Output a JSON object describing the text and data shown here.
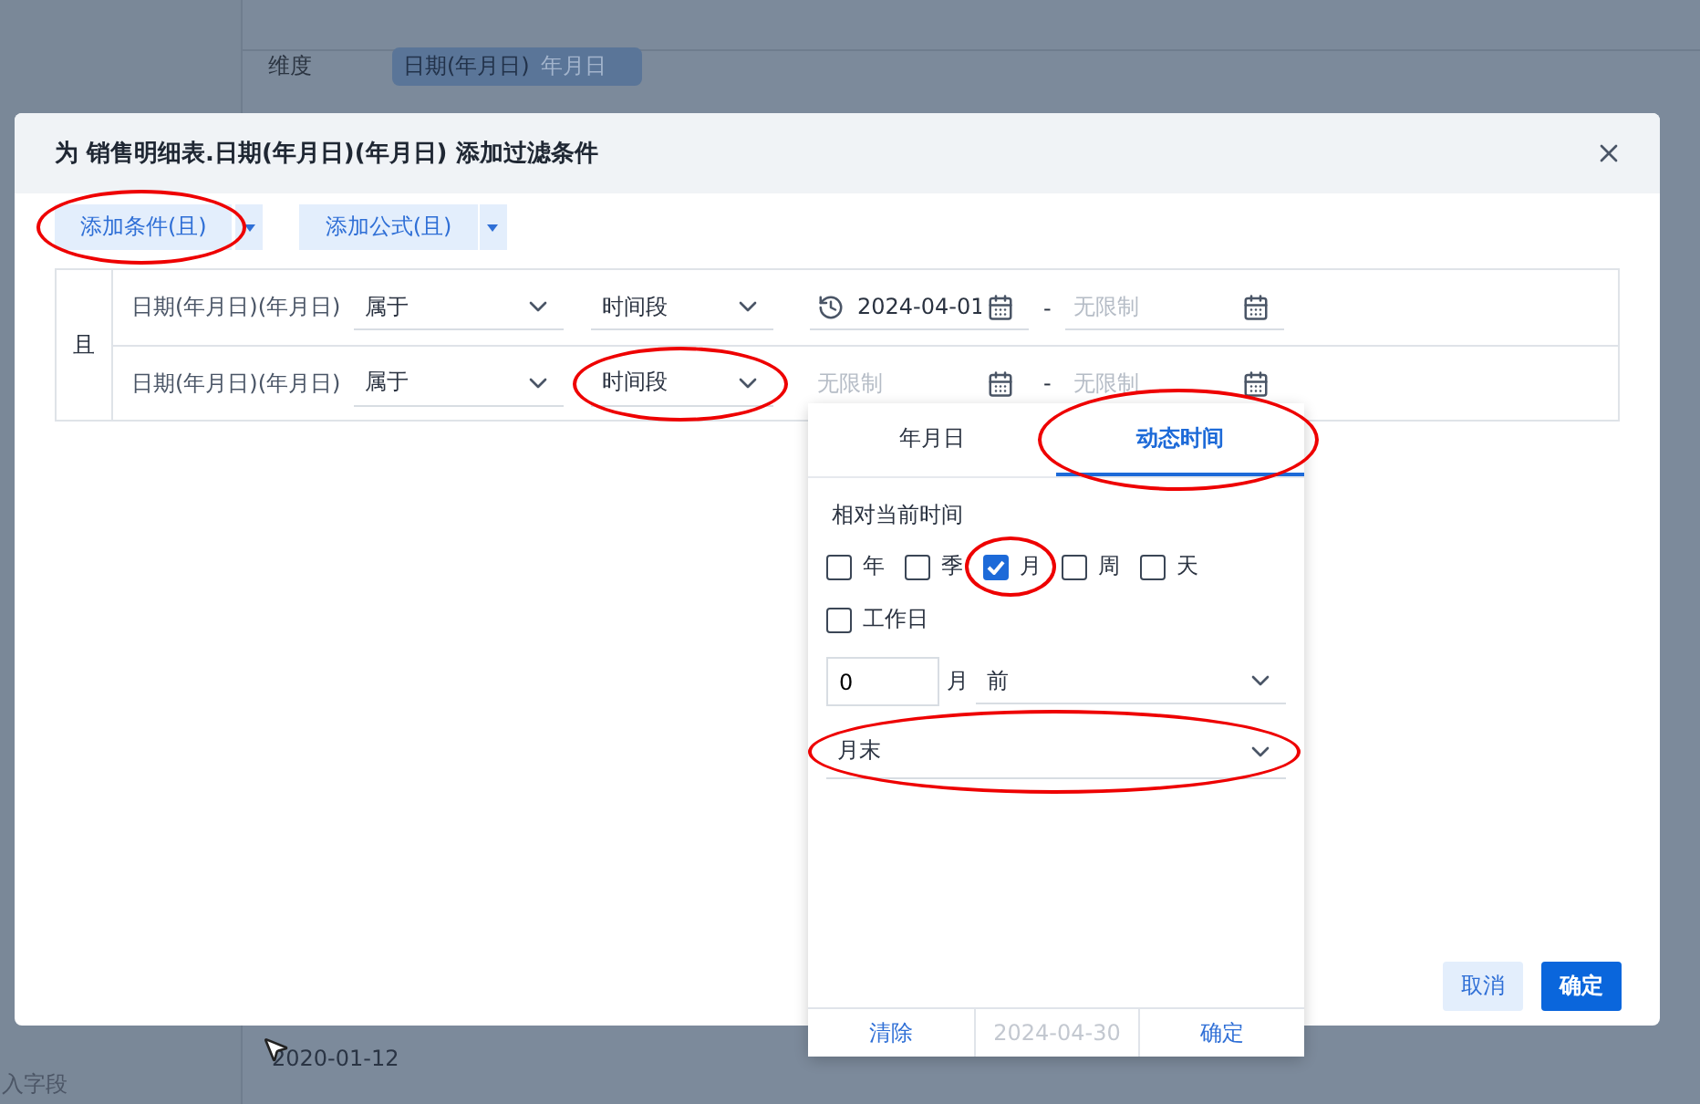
{
  "background": {
    "dimension_label": "维度",
    "dimension_tag": "日期(年月日)",
    "dimension_tag_hint": "年月日",
    "cell": "2020-01-12",
    "sidebar_text": "入字段"
  },
  "dialog": {
    "title": "为 销售明细表.日期(年月日)(年月日) 添加过滤条件",
    "add_buttons": [
      {
        "label": "添加条件(且)",
        "circled": true
      },
      {
        "label": "添加公式(且)",
        "circled": false
      }
    ],
    "logic": "且",
    "conditions": [
      {
        "field": "日期(年月日)(年月日)",
        "operator": "属于",
        "type": "时间段",
        "type_circled": false,
        "start": {
          "value": "2024-04-01",
          "dynamic": true,
          "focused": false
        },
        "separator": "-",
        "end": {
          "placeholder": "无限制"
        }
      },
      {
        "field": "日期(年月日)(年月日)",
        "operator": "属于",
        "type": "时间段",
        "type_circled": true,
        "start": {
          "placeholder": "无限制",
          "dynamic": false,
          "focused": true
        },
        "separator": "-",
        "end": {
          "placeholder": "无限制"
        }
      }
    ],
    "buttons": [
      {
        "label": "取消",
        "kind": "secondary"
      },
      {
        "label": "确定",
        "kind": "primary"
      }
    ]
  },
  "popup": {
    "tabs": [
      {
        "label": "年月日",
        "selected": false,
        "circled": false
      },
      {
        "label": "动态时间",
        "selected": true,
        "circled": true
      }
    ],
    "section_label": "相对当前时间",
    "units": [
      {
        "label": "年",
        "checked": false,
        "circled": false
      },
      {
        "label": "季",
        "checked": false,
        "circled": false
      },
      {
        "label": "月",
        "checked": true,
        "circled": true
      },
      {
        "label": "周",
        "checked": false,
        "circled": false
      },
      {
        "label": "天",
        "checked": false,
        "circled": false
      }
    ],
    "workday": {
      "label": "工作日",
      "checked": false
    },
    "offset": {
      "value": "0",
      "unit": "月",
      "direction": "前"
    },
    "anchor": {
      "value": "月末",
      "circled": true
    },
    "footer": {
      "clear": "清除",
      "preview": "2024-04-30",
      "confirm": "确定"
    }
  }
}
